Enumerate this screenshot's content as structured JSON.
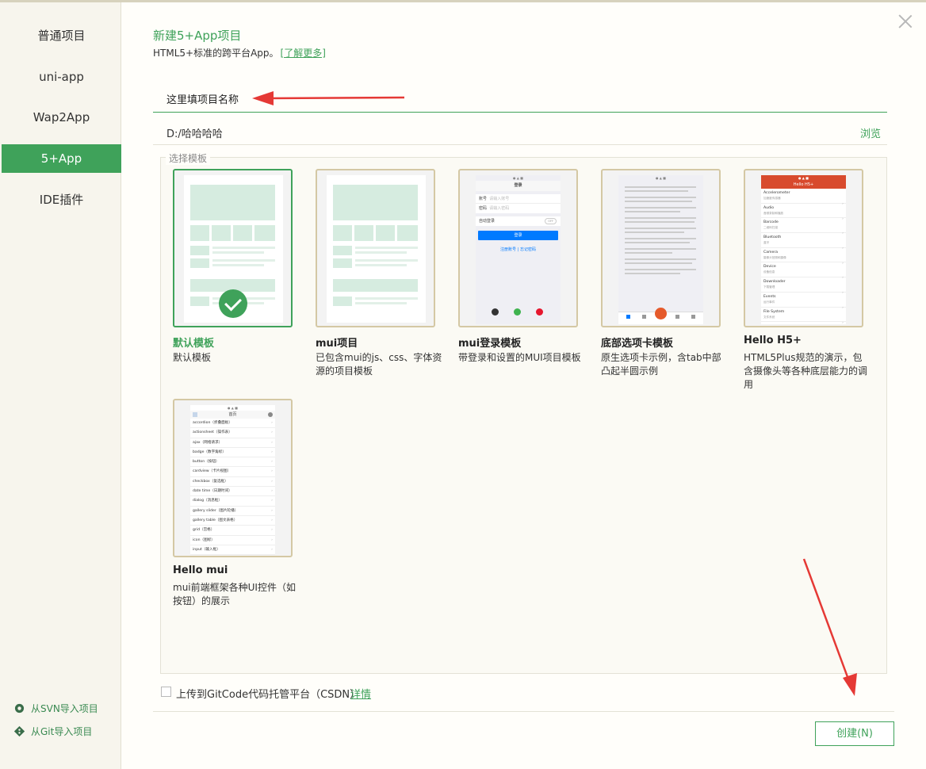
{
  "sidebar": {
    "items": [
      {
        "label": "普通项目"
      },
      {
        "label": "uni-app"
      },
      {
        "label": "Wap2App"
      },
      {
        "label": "5+App"
      },
      {
        "label": "IDE插件"
      }
    ],
    "active_index": 3,
    "links": [
      {
        "label": "从SVN导入项目"
      },
      {
        "label": "从Git导入项目"
      }
    ]
  },
  "header": {
    "title": "新建5+App项目",
    "subtitle": "HTML5+标准的跨平台App。",
    "learn_more": "[了解更多]"
  },
  "form": {
    "project_name": "这里填项目名称",
    "path": "D:/哈哈哈哈",
    "browse_label": "浏览",
    "template_legend": "选择模板"
  },
  "templates": [
    {
      "name": "默认模板",
      "desc": "默认模板",
      "selected": true
    },
    {
      "name": "mui项目",
      "desc": "已包含mui的js、css、字体资源的项目模板",
      "selected": false
    },
    {
      "name": "mui登录模板",
      "desc": "带登录和设置的MUI项目模板",
      "selected": false
    },
    {
      "name": "底部选项卡模板",
      "desc": "原生选项卡示例，含tab中部凸起半圆示例",
      "selected": false
    },
    {
      "name": "Hello H5+",
      "desc": "HTML5Plus规范的演示，包含摄像头等各种底层能力的调用",
      "selected": false
    },
    {
      "name": "Hello mui",
      "desc": "mui前端框架各种UI控件（如按钮）的展示",
      "selected": false
    }
  ],
  "thumbs": {
    "login": {
      "title": "登录",
      "account_label": "账号",
      "account_ph": "请输入账号",
      "password_label": "密码",
      "password_ph": "请输入密码",
      "auto_login": "自动登录",
      "toggle": "OFF",
      "login_button": "登录",
      "register": "注册账号",
      "forgot": "忘记密码"
    },
    "h5plus": {
      "title": "Hello H5+",
      "items": [
        {
          "name": "Accelerometer",
          "sub": "加速度传感器"
        },
        {
          "name": "Audio",
          "sub": "音频录制和播放"
        },
        {
          "name": "Barcode",
          "sub": "二维码扫描"
        },
        {
          "name": "Bluetooth",
          "sub": "蓝牙"
        },
        {
          "name": "Camera",
          "sub": "摄像头拍照和摄像"
        },
        {
          "name": "Device",
          "sub": "设备信息"
        },
        {
          "name": "Downloader",
          "sub": "下载管理"
        },
        {
          "name": "Events",
          "sub": "运行事件"
        },
        {
          "name": "File System",
          "sub": "文件系统"
        }
      ]
    },
    "mui": {
      "title": "首页",
      "items": [
        "accordion（折叠面板）",
        "actionsheet（操作表）",
        "ajax（网络请求）",
        "badge（数字角标）",
        "button（按钮）",
        "cardview（卡片视图）",
        "checkbox（复选框）",
        "date time（日期时间）",
        "dialog（消息框）",
        "gallery slider（图片轮播）",
        "gallery table（图文表格）",
        "grid（宫格）",
        "icon（图标）",
        "input（输入框）"
      ]
    }
  },
  "upload": {
    "label": "上传到GitCode代码托管平台（CSDN）",
    "detail": "详情"
  },
  "create_button": "创建(N)",
  "colors": {
    "accent": "#3fa25a",
    "annotation_arrow": "#e53935"
  }
}
